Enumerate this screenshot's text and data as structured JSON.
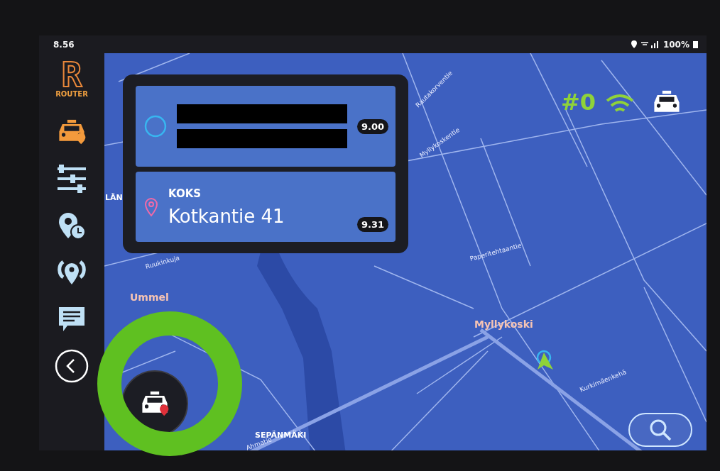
{
  "status_bar": {
    "time": "8.56",
    "battery": "100%"
  },
  "sidebar": {
    "logo_letter": "R",
    "logo_text": "ROUTER",
    "items": [
      {
        "kind": "taxi",
        "selected": true
      },
      {
        "kind": "sliders",
        "selected": false
      },
      {
        "kind": "pin-clock",
        "selected": false
      },
      {
        "kind": "pin-signal",
        "selected": false
      },
      {
        "kind": "message",
        "selected": false
      },
      {
        "kind": "back",
        "selected": false
      }
    ]
  },
  "route_card": {
    "stops": [
      {
        "kind": "start",
        "redacted": true,
        "time": "9.00"
      },
      {
        "kind": "destination",
        "redacted": false,
        "label": "KOKS",
        "address": "Kotkantie 41",
        "time": "9.31"
      }
    ]
  },
  "vehicle_status": {
    "number": "#0",
    "connected": true
  },
  "map": {
    "places": [
      {
        "text": "LÄN",
        "kind": "area"
      },
      {
        "text": "Ummel",
        "kind": "district"
      },
      {
        "text": "Myllykoski",
        "kind": "district"
      },
      {
        "text": "SEPÄNMÄKI",
        "kind": "area"
      }
    ],
    "streets": [
      "Ruukinkuja",
      "Rautakorventie",
      "Myllykoskentie",
      "Paperitehtaantie",
      "Kurkimäenkehä",
      "Ahmatie"
    ]
  }
}
